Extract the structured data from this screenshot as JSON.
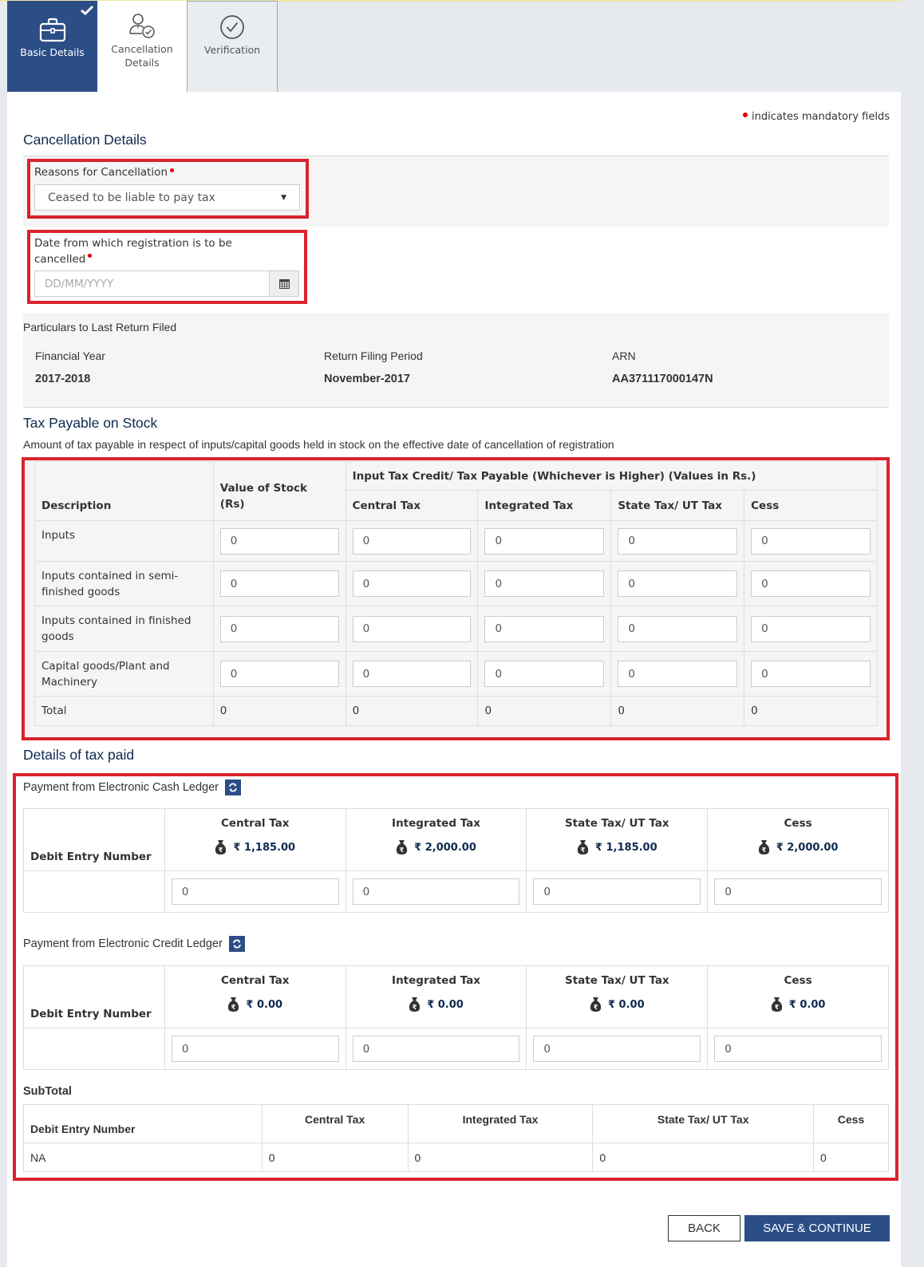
{
  "tabs": [
    {
      "label": "Basic Details",
      "icon": "briefcase-icon",
      "completed": true,
      "active": true
    },
    {
      "label": "Cancellation Details",
      "label_line1": "Cancellation",
      "label_line2": "Details",
      "icon": "user-check-icon",
      "active": false
    },
    {
      "label": "Verification",
      "icon": "circle-check-icon",
      "active": false
    }
  ],
  "mandatory_note": "indicates mandatory fields",
  "cancellation": {
    "title": "Cancellation Details",
    "reason_label": "Reasons for Cancellation",
    "reason_value": "Ceased to be liable to pay tax",
    "date_label_line1": "Date from which registration is to be",
    "date_label_line2": "cancelled",
    "date_placeholder": "DD/MM/YYYY"
  },
  "last_return": {
    "title": "Particulars to Last Return Filed",
    "fields": [
      {
        "label": "Financial Year",
        "value": "2017-2018"
      },
      {
        "label": "Return Filing Period",
        "value": "November-2017"
      },
      {
        "label": "ARN",
        "value": "AA371117000147N"
      }
    ]
  },
  "stock": {
    "title": "Tax Payable on Stock",
    "subtitle": "Amount of tax payable in respect of inputs/capital goods held in stock on the effective date of cancellation of registration",
    "col_description": "Description",
    "col_value_line1": "Value of Stock",
    "col_value_line2": "(Rs)",
    "group_header": "Input Tax Credit/ Tax Payable (Whichever is Higher) (Values in Rs.)",
    "tax_cols": [
      "Central Tax",
      "Integrated Tax",
      "State Tax/ UT Tax",
      "Cess"
    ],
    "rows": [
      {
        "desc_line1": "Inputs",
        "desc_line2": "",
        "values": [
          "0",
          "0",
          "0",
          "0",
          "0"
        ]
      },
      {
        "desc_line1": "Inputs contained in semi-",
        "desc_line2": "finished goods",
        "values": [
          "0",
          "0",
          "0",
          "0",
          "0"
        ]
      },
      {
        "desc_line1": "Inputs contained in finished",
        "desc_line2": "goods",
        "values": [
          "0",
          "0",
          "0",
          "0",
          "0"
        ]
      },
      {
        "desc_line1": "Capital goods/Plant and",
        "desc_line2": "Machinery",
        "values": [
          "0",
          "0",
          "0",
          "0",
          "0"
        ]
      }
    ],
    "total_label": "Total",
    "totals": [
      "0",
      "0",
      "0",
      "0",
      "0"
    ]
  },
  "tax_paid": {
    "title": "Details of tax paid",
    "cash": {
      "label": "Payment from Electronic Cash Ledger",
      "debit_header": "Debit Entry Number",
      "cols": [
        {
          "name": "Central Tax",
          "balance": "₹ 1,185.00",
          "value": "0"
        },
        {
          "name": "Integrated Tax",
          "balance": "₹ 2,000.00",
          "value": "0"
        },
        {
          "name": "State Tax/ UT Tax",
          "balance": "₹ 1,185.00",
          "value": "0"
        },
        {
          "name": "Cess",
          "balance": "₹ 2,000.00",
          "value": "0"
        }
      ]
    },
    "credit": {
      "label": "Payment from Electronic Credit Ledger",
      "debit_header": "Debit Entry Number",
      "cols": [
        {
          "name": "Central Tax",
          "balance": "₹ 0.00",
          "value": "0"
        },
        {
          "name": "Integrated Tax",
          "balance": "₹ 0.00",
          "value": "0"
        },
        {
          "name": "State Tax/ UT Tax",
          "balance": "₹ 0.00",
          "value": "0"
        },
        {
          "name": "Cess",
          "balance": "₹ 0.00",
          "value": "0"
        }
      ]
    },
    "subtotal": {
      "title": "SubTotal",
      "headers": [
        "Debit Entry Number",
        "Central Tax",
        "Integrated Tax",
        "State Tax/ UT Tax",
        "Cess"
      ],
      "row": [
        "NA",
        "0",
        "0",
        "0",
        "0"
      ]
    }
  },
  "buttons": {
    "back": "BACK",
    "save": "SAVE & CONTINUE"
  },
  "colors": {
    "primary": "#2c4e86",
    "highlight": "#d9232d",
    "required": "#dd0000"
  }
}
